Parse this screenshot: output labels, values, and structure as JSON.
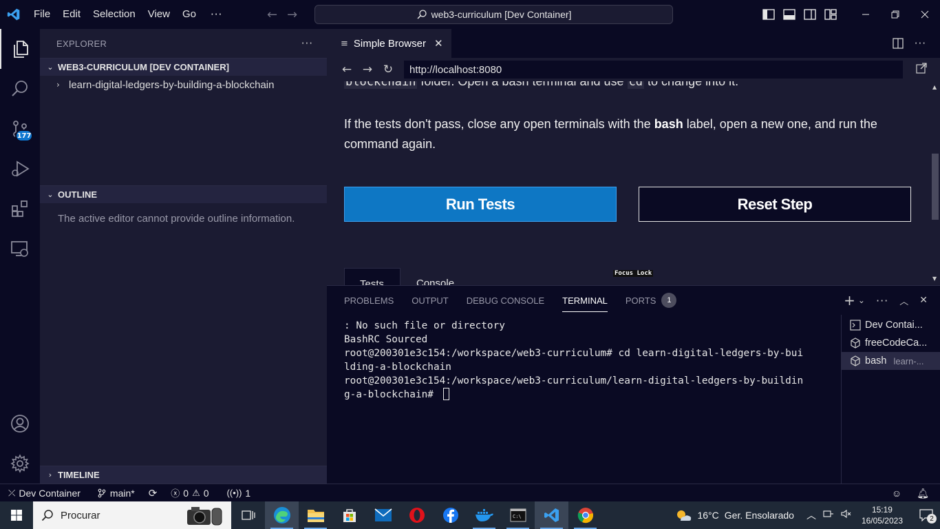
{
  "titlebar": {
    "menu": [
      "File",
      "Edit",
      "Selection",
      "View",
      "Go"
    ],
    "more": "···",
    "command_center": "web3-curriculum [Dev Container]"
  },
  "activitybar": {
    "source_control_badge": "177"
  },
  "sidebar": {
    "title": "EXPLORER",
    "more": "···",
    "workspace": "WEB3-CURRICULUM [DEV CONTAINER]",
    "folder": "learn-digital-ledgers-by-building-a-blockchain",
    "outline_title": "OUTLINE",
    "outline_message": "The active editor cannot provide outline information.",
    "timeline_title": "TIMELINE"
  },
  "editor": {
    "tab_label": "Simple Browser",
    "url": "http://localhost:8080",
    "clip_line_code1": "blockchain",
    "clip_line_mid": " folder. Open a bash terminal and use ",
    "clip_line_code2": "cd",
    "clip_line_end": " to change into it.",
    "para_start": "If the tests don't pass, close any open terminals with the ",
    "para_bold": "bash",
    "para_end": " label, open a new one, and run the command again.",
    "run_tests": "Run Tests",
    "reset_step": "Reset Step",
    "tab_tests": "Tests",
    "tab_console": "Console",
    "focus_lock": "Focus Lock"
  },
  "panel": {
    "tabs": [
      "PROBLEMS",
      "OUTPUT",
      "DEBUG CONSOLE",
      "TERMINAL",
      "PORTS"
    ],
    "ports_count": "1",
    "active_tab": "TERMINAL",
    "terminal_lines": [
      ": No such file or directory",
      "BashRC Sourced",
      "root@200301e3c154:/workspace/web3-curriculum# cd learn-digital-ledgers-by-bui",
      "lding-a-blockchain",
      "root@200301e3c154:/workspace/web3-curriculum/learn-digital-ledgers-by-buildin",
      "g-a-blockchain# "
    ],
    "terminals": [
      {
        "name": "Dev Contai...",
        "sub": ""
      },
      {
        "name": "freeCodeCa...",
        "sub": ""
      },
      {
        "name": "bash",
        "sub": "learn-..."
      }
    ]
  },
  "statusbar": {
    "remote": "Dev Container",
    "branch": "main*",
    "errors": "0",
    "warnings": "0",
    "ports": "1"
  },
  "taskbar": {
    "search_placeholder": "Procurar",
    "temperature": "16°C",
    "weather": "Ger. Ensolarado",
    "time": "15:19",
    "date": "16/05/2023",
    "notifications": "2"
  },
  "colors": {
    "accent": "#0e77c4",
    "background": "#0a0a23",
    "panel": "#1b1b32"
  }
}
